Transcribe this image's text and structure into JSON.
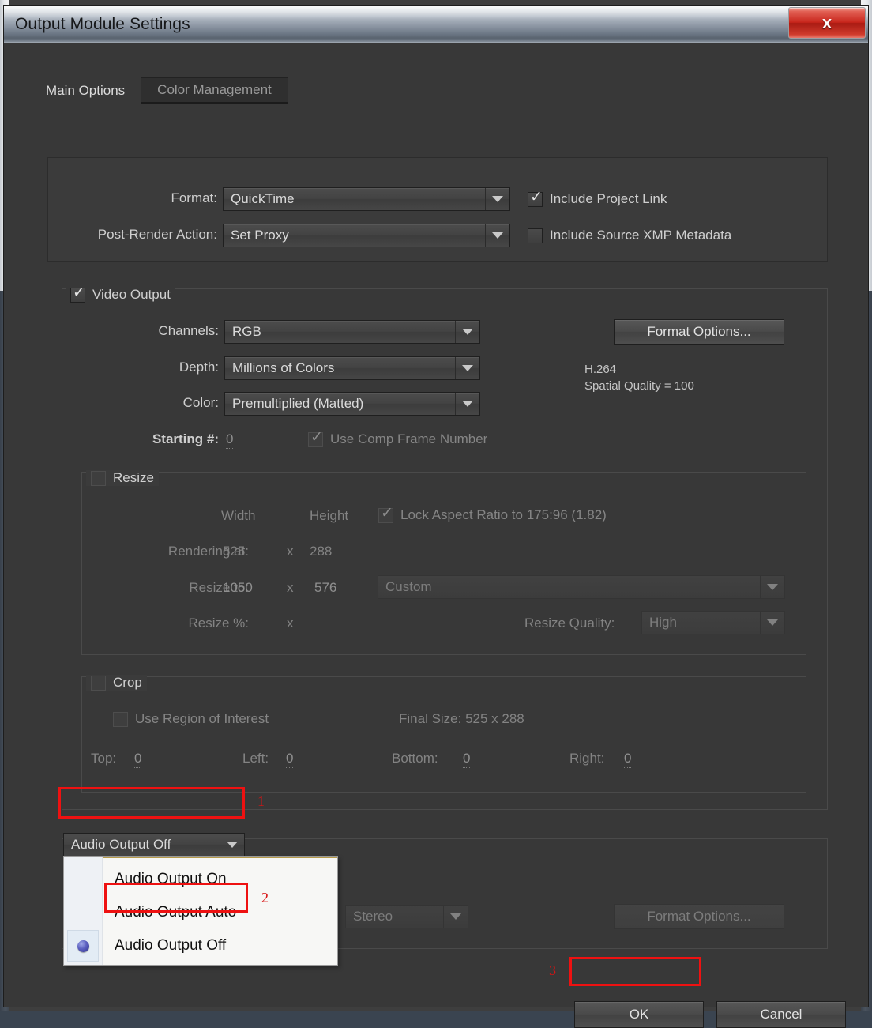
{
  "window": {
    "title": "Output Module Settings",
    "close_icon": "close-x-icon",
    "close_label": "x"
  },
  "tabs": [
    {
      "label": "Main Options",
      "active": true
    },
    {
      "label": "Color Management",
      "active": false
    }
  ],
  "format_panel": {
    "format_label": "Format:",
    "format_value": "QuickTime",
    "post_render_label": "Post-Render Action:",
    "post_render_value": "Set Proxy",
    "include_project_link": {
      "label": "Include Project Link",
      "checked": true
    },
    "include_xmp": {
      "label": "Include Source XMP Metadata",
      "checked": false
    }
  },
  "video_output": {
    "group_label": "Video Output",
    "group_checked": true,
    "channels_label": "Channels:",
    "channels_value": "RGB",
    "depth_label": "Depth:",
    "depth_value": "Millions of Colors",
    "color_label": "Color:",
    "color_value": "Premultiplied (Matted)",
    "starting_num_label": "Starting #:",
    "starting_num_value": "0",
    "use_comp_frame_number": {
      "label": "Use Comp Frame Number",
      "checked": true
    },
    "format_options_label": "Format Options...",
    "codec_name": "H.264",
    "codec_quality": "Spatial Quality = 100"
  },
  "resize": {
    "group_label": "Resize",
    "group_checked": false,
    "width_header": "Width",
    "height_header": "Height",
    "lock_aspect": {
      "label": "Lock Aspect Ratio to 175:96 (1.82)",
      "checked": true
    },
    "rendering_at_label": "Rendering at:",
    "rendering_width": "525",
    "rendering_x": "x",
    "rendering_height": "288",
    "resize_to_label": "Resize to:",
    "resize_width": "1050",
    "resize_x": "x",
    "resize_height": "576",
    "preset_value": "Custom",
    "resize_pct_label": "Resize %:",
    "resize_pct_x": "x",
    "resize_quality_label": "Resize Quality:",
    "resize_quality_value": "High"
  },
  "crop": {
    "group_label": "Crop",
    "group_checked": false,
    "use_region_of_interest": {
      "label": "Use Region of Interest",
      "checked": false
    },
    "final_size_label": "Final Size: 525 x 288",
    "top_label": "Top:",
    "top_value": "0",
    "left_label": "Left:",
    "left_value": "0",
    "bottom_label": "Bottom:",
    "bottom_value": "0",
    "right_label": "Right:",
    "right_value": "0"
  },
  "audio_output": {
    "selected_value": "Audio Output Off",
    "menu_items": [
      {
        "label": "Audio Output On",
        "selected": false
      },
      {
        "label": "Audio Output Auto",
        "selected": false
      },
      {
        "label": "Audio Output Off",
        "selected": true
      }
    ],
    "channels_value": "Stereo",
    "format_options_label": "Format Options..."
  },
  "footer": {
    "ok_label": "OK",
    "cancel_label": "Cancel"
  },
  "annotations": {
    "step1": "1",
    "step2": "2",
    "step3": "3",
    "color": "#ee1111"
  }
}
